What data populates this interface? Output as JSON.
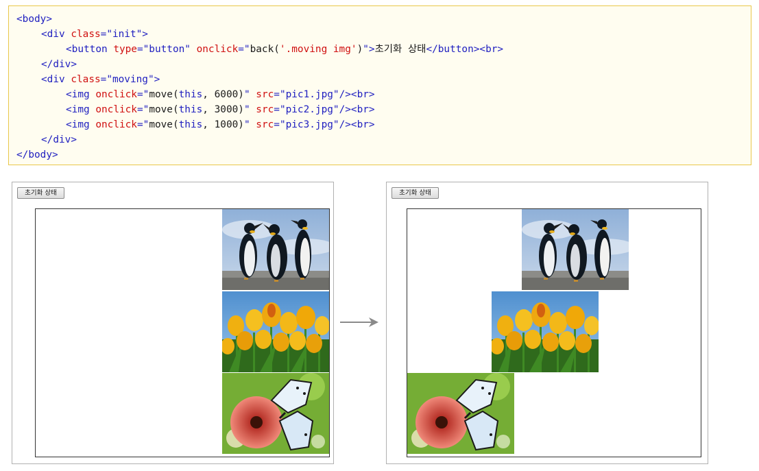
{
  "code": {
    "lines": [
      {
        "indent": 0,
        "parts": [
          {
            "t": "<body>",
            "c": "tag"
          }
        ]
      },
      {
        "indent": 1,
        "parts": [
          {
            "t": "<div ",
            "c": "tag"
          },
          {
            "t": "class",
            "c": "attr"
          },
          {
            "t": "=\"",
            "c": "tag"
          },
          {
            "t": "init",
            "c": "val"
          },
          {
            "t": "\">",
            "c": "tag"
          }
        ]
      },
      {
        "indent": 2,
        "parts": [
          {
            "t": "<button ",
            "c": "tag"
          },
          {
            "t": "type",
            "c": "attr"
          },
          {
            "t": "=\"",
            "c": "tag"
          },
          {
            "t": "button",
            "c": "val"
          },
          {
            "t": "\" ",
            "c": "tag"
          },
          {
            "t": "onclick",
            "c": "attr"
          },
          {
            "t": "=\"",
            "c": "tag"
          },
          {
            "t": "back(",
            "c": "txt"
          },
          {
            "t": "'.moving img'",
            "c": "attr"
          },
          {
            "t": ")",
            "c": "txt"
          },
          {
            "t": "\">",
            "c": "tag"
          },
          {
            "t": "초기화 상태",
            "c": "txt"
          },
          {
            "t": "</button><br>",
            "c": "tag"
          }
        ]
      },
      {
        "indent": 1,
        "parts": [
          {
            "t": "</div>",
            "c": "tag"
          }
        ]
      },
      {
        "indent": 1,
        "parts": [
          {
            "t": "<div ",
            "c": "tag"
          },
          {
            "t": "class",
            "c": "attr"
          },
          {
            "t": "=\"",
            "c": "tag"
          },
          {
            "t": "moving",
            "c": "val"
          },
          {
            "t": "\">",
            "c": "tag"
          }
        ]
      },
      {
        "indent": 2,
        "parts": [
          {
            "t": "<img ",
            "c": "tag"
          },
          {
            "t": "onclick",
            "c": "attr"
          },
          {
            "t": "=\"",
            "c": "tag"
          },
          {
            "t": "move(",
            "c": "txt"
          },
          {
            "t": "this",
            "c": "kw"
          },
          {
            "t": ", 6000)",
            "c": "txt"
          },
          {
            "t": "\" ",
            "c": "tag"
          },
          {
            "t": "src",
            "c": "attr"
          },
          {
            "t": "=\"",
            "c": "tag"
          },
          {
            "t": "pic1.jpg",
            "c": "val"
          },
          {
            "t": "\"/><br>",
            "c": "tag"
          }
        ]
      },
      {
        "indent": 2,
        "parts": [
          {
            "t": "<img ",
            "c": "tag"
          },
          {
            "t": "onclick",
            "c": "attr"
          },
          {
            "t": "=\"",
            "c": "tag"
          },
          {
            "t": "move(",
            "c": "txt"
          },
          {
            "t": "this",
            "c": "kw"
          },
          {
            "t": ", 3000)",
            "c": "txt"
          },
          {
            "t": "\" ",
            "c": "tag"
          },
          {
            "t": "src",
            "c": "attr"
          },
          {
            "t": "=\"",
            "c": "tag"
          },
          {
            "t": "pic2.jpg",
            "c": "val"
          },
          {
            "t": "\"/><br>",
            "c": "tag"
          }
        ]
      },
      {
        "indent": 2,
        "parts": [
          {
            "t": "<img ",
            "c": "tag"
          },
          {
            "t": "onclick",
            "c": "attr"
          },
          {
            "t": "=\"",
            "c": "tag"
          },
          {
            "t": "move(",
            "c": "txt"
          },
          {
            "t": "this",
            "c": "kw"
          },
          {
            "t": ", 1000)",
            "c": "txt"
          },
          {
            "t": "\" ",
            "c": "tag"
          },
          {
            "t": "src",
            "c": "attr"
          },
          {
            "t": "=\"",
            "c": "tag"
          },
          {
            "t": "pic3.jpg",
            "c": "val"
          },
          {
            "t": "\"/><br>",
            "c": "tag"
          }
        ]
      },
      {
        "indent": 1,
        "parts": [
          {
            "t": "</div>",
            "c": "tag"
          }
        ]
      },
      {
        "indent": 0,
        "parts": [
          {
            "t": "</body>",
            "c": "tag"
          }
        ]
      }
    ]
  },
  "before": {
    "button_label": "초기화 상태",
    "images": [
      {
        "name": "penguins-image",
        "subject": "penguins"
      },
      {
        "name": "tulips-image",
        "subject": "tulips"
      },
      {
        "name": "butterfly-image",
        "subject": "butterfly"
      }
    ]
  },
  "after": {
    "button_label": "초기화 상태",
    "images": [
      {
        "name": "penguins-image",
        "subject": "penguins"
      },
      {
        "name": "tulips-image",
        "subject": "tulips"
      },
      {
        "name": "butterfly-image",
        "subject": "butterfly"
      }
    ]
  },
  "arrow_icon": "right-arrow-icon",
  "colors": {
    "tag": "#2020c0",
    "attribute": "#d01010",
    "code_background": "#fffdf0",
    "code_border": "#e8c74a"
  }
}
